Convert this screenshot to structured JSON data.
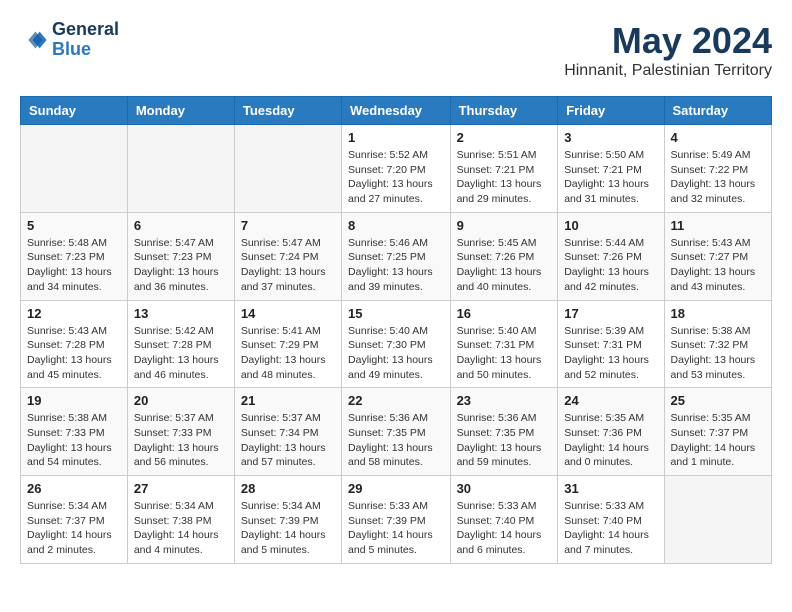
{
  "header": {
    "logo_line1": "General",
    "logo_line2": "Blue",
    "month": "May 2024",
    "location": "Hinnanit, Palestinian Territory"
  },
  "days_of_week": [
    "Sunday",
    "Monday",
    "Tuesday",
    "Wednesday",
    "Thursday",
    "Friday",
    "Saturday"
  ],
  "weeks": [
    [
      {
        "day": "",
        "info": ""
      },
      {
        "day": "",
        "info": ""
      },
      {
        "day": "",
        "info": ""
      },
      {
        "day": "1",
        "info": "Sunrise: 5:52 AM\nSunset: 7:20 PM\nDaylight: 13 hours and 27 minutes."
      },
      {
        "day": "2",
        "info": "Sunrise: 5:51 AM\nSunset: 7:21 PM\nDaylight: 13 hours and 29 minutes."
      },
      {
        "day": "3",
        "info": "Sunrise: 5:50 AM\nSunset: 7:21 PM\nDaylight: 13 hours and 31 minutes."
      },
      {
        "day": "4",
        "info": "Sunrise: 5:49 AM\nSunset: 7:22 PM\nDaylight: 13 hours and 32 minutes."
      }
    ],
    [
      {
        "day": "5",
        "info": "Sunrise: 5:48 AM\nSunset: 7:23 PM\nDaylight: 13 hours and 34 minutes."
      },
      {
        "day": "6",
        "info": "Sunrise: 5:47 AM\nSunset: 7:23 PM\nDaylight: 13 hours and 36 minutes."
      },
      {
        "day": "7",
        "info": "Sunrise: 5:47 AM\nSunset: 7:24 PM\nDaylight: 13 hours and 37 minutes."
      },
      {
        "day": "8",
        "info": "Sunrise: 5:46 AM\nSunset: 7:25 PM\nDaylight: 13 hours and 39 minutes."
      },
      {
        "day": "9",
        "info": "Sunrise: 5:45 AM\nSunset: 7:26 PM\nDaylight: 13 hours and 40 minutes."
      },
      {
        "day": "10",
        "info": "Sunrise: 5:44 AM\nSunset: 7:26 PM\nDaylight: 13 hours and 42 minutes."
      },
      {
        "day": "11",
        "info": "Sunrise: 5:43 AM\nSunset: 7:27 PM\nDaylight: 13 hours and 43 minutes."
      }
    ],
    [
      {
        "day": "12",
        "info": "Sunrise: 5:43 AM\nSunset: 7:28 PM\nDaylight: 13 hours and 45 minutes."
      },
      {
        "day": "13",
        "info": "Sunrise: 5:42 AM\nSunset: 7:28 PM\nDaylight: 13 hours and 46 minutes."
      },
      {
        "day": "14",
        "info": "Sunrise: 5:41 AM\nSunset: 7:29 PM\nDaylight: 13 hours and 48 minutes."
      },
      {
        "day": "15",
        "info": "Sunrise: 5:40 AM\nSunset: 7:30 PM\nDaylight: 13 hours and 49 minutes."
      },
      {
        "day": "16",
        "info": "Sunrise: 5:40 AM\nSunset: 7:31 PM\nDaylight: 13 hours and 50 minutes."
      },
      {
        "day": "17",
        "info": "Sunrise: 5:39 AM\nSunset: 7:31 PM\nDaylight: 13 hours and 52 minutes."
      },
      {
        "day": "18",
        "info": "Sunrise: 5:38 AM\nSunset: 7:32 PM\nDaylight: 13 hours and 53 minutes."
      }
    ],
    [
      {
        "day": "19",
        "info": "Sunrise: 5:38 AM\nSunset: 7:33 PM\nDaylight: 13 hours and 54 minutes."
      },
      {
        "day": "20",
        "info": "Sunrise: 5:37 AM\nSunset: 7:33 PM\nDaylight: 13 hours and 56 minutes."
      },
      {
        "day": "21",
        "info": "Sunrise: 5:37 AM\nSunset: 7:34 PM\nDaylight: 13 hours and 57 minutes."
      },
      {
        "day": "22",
        "info": "Sunrise: 5:36 AM\nSunset: 7:35 PM\nDaylight: 13 hours and 58 minutes."
      },
      {
        "day": "23",
        "info": "Sunrise: 5:36 AM\nSunset: 7:35 PM\nDaylight: 13 hours and 59 minutes."
      },
      {
        "day": "24",
        "info": "Sunrise: 5:35 AM\nSunset: 7:36 PM\nDaylight: 14 hours and 0 minutes."
      },
      {
        "day": "25",
        "info": "Sunrise: 5:35 AM\nSunset: 7:37 PM\nDaylight: 14 hours and 1 minute."
      }
    ],
    [
      {
        "day": "26",
        "info": "Sunrise: 5:34 AM\nSunset: 7:37 PM\nDaylight: 14 hours and 2 minutes."
      },
      {
        "day": "27",
        "info": "Sunrise: 5:34 AM\nSunset: 7:38 PM\nDaylight: 14 hours and 4 minutes."
      },
      {
        "day": "28",
        "info": "Sunrise: 5:34 AM\nSunset: 7:39 PM\nDaylight: 14 hours and 5 minutes."
      },
      {
        "day": "29",
        "info": "Sunrise: 5:33 AM\nSunset: 7:39 PM\nDaylight: 14 hours and 5 minutes."
      },
      {
        "day": "30",
        "info": "Sunrise: 5:33 AM\nSunset: 7:40 PM\nDaylight: 14 hours and 6 minutes."
      },
      {
        "day": "31",
        "info": "Sunrise: 5:33 AM\nSunset: 7:40 PM\nDaylight: 14 hours and 7 minutes."
      },
      {
        "day": "",
        "info": ""
      }
    ]
  ]
}
